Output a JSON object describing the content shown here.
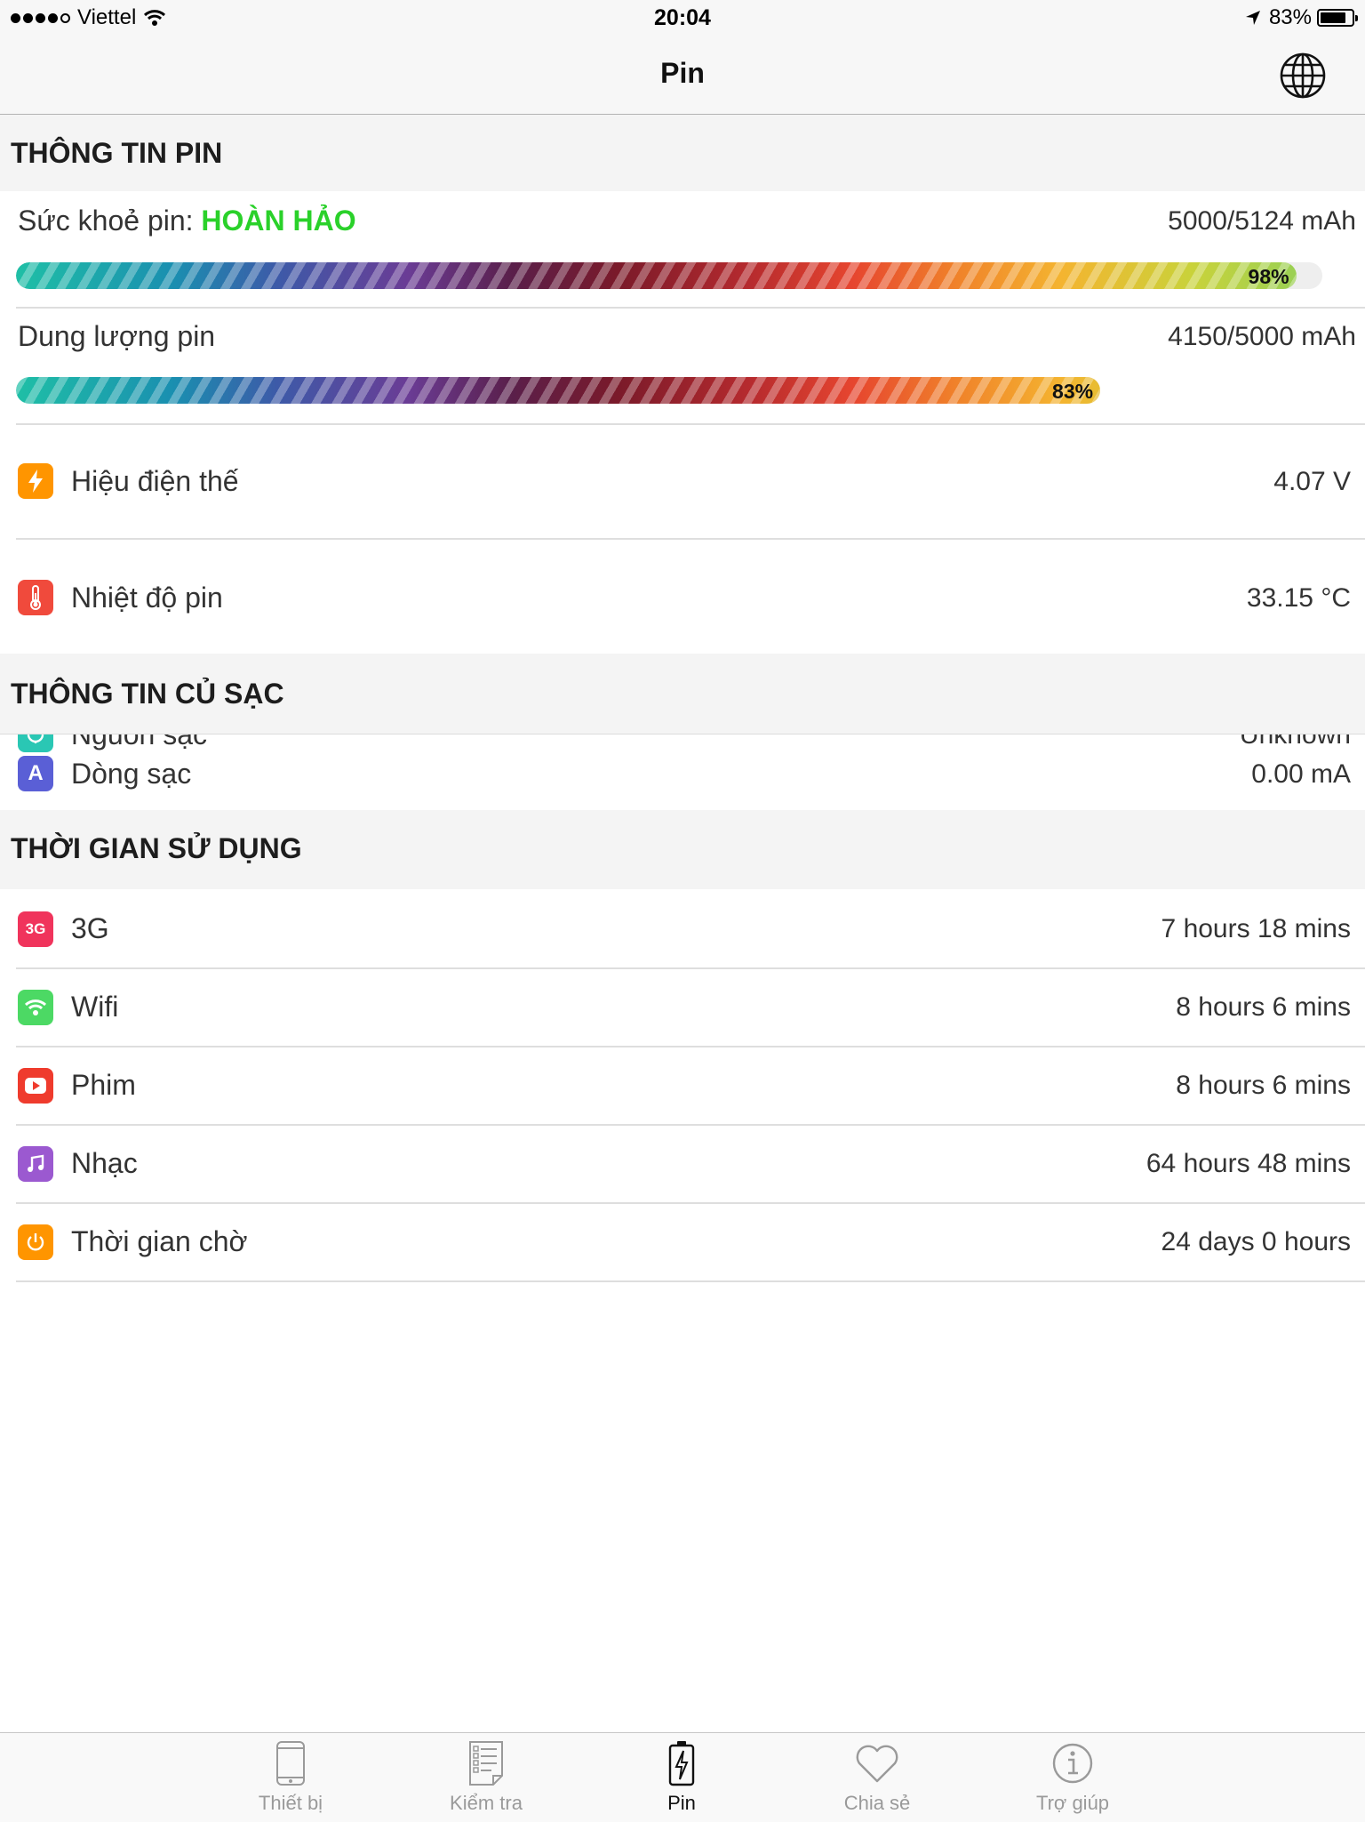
{
  "status_bar": {
    "carrier": "Viettel",
    "time": "20:04",
    "battery_text": "83%",
    "battery_level": 0.83
  },
  "nav": {
    "title": "Pin"
  },
  "battery_section": {
    "header": "THÔNG TIN PIN",
    "health": {
      "label": "Sức khoẻ pin: ",
      "status": "HOÀN HẢO",
      "value": "5000/5124 mAh",
      "percent_text": "98%",
      "percent": 98
    },
    "capacity": {
      "label": "Dung lượng pin",
      "value": "4150/5000 mAh",
      "percent_text": "83%",
      "percent": 83
    },
    "voltage": {
      "label": "Hiệu điện thế",
      "value": "4.07 V"
    },
    "temperature": {
      "label": "Nhiệt độ pin",
      "value": "33.15 °C"
    }
  },
  "charger_section": {
    "header": "THÔNG TIN CỦ SẠC",
    "source": {
      "label": "Nguồn sạc",
      "value": "Unknown"
    },
    "current": {
      "label": "Dòng sạc",
      "value": "0.00 mA",
      "icon_text": "A"
    }
  },
  "usage_section": {
    "header": "THỜI GIAN SỬ DỤNG",
    "items": [
      {
        "label": "3G",
        "value": "7 hours 18 mins",
        "icon_text": "3G"
      },
      {
        "label": "Wifi",
        "value": "8 hours 6 mins"
      },
      {
        "label": "Phim",
        "value": "8 hours 6 mins"
      },
      {
        "label": "Nhạc",
        "value": "64 hours 48 mins"
      },
      {
        "label": "Thời gian chờ",
        "value": "24 days 0 hours"
      }
    ]
  },
  "tabs": [
    {
      "label": "Thiết bị"
    },
    {
      "label": "Kiểm tra"
    },
    {
      "label": "Pin"
    },
    {
      "label": "Chia sẻ"
    },
    {
      "label": "Trợ giúp"
    }
  ],
  "colors": {
    "health_status": "#2ad12a",
    "voltage_icon": "#ff9500",
    "temperature_icon": "#f04a3c",
    "source_icon": "#2ac7b4",
    "current_icon": "#5a5fd6",
    "icon_3g": "#f0345c",
    "icon_wifi": "#4cd964",
    "icon_movie": "#ef3b2d",
    "icon_music": "#9b59d0",
    "icon_standby": "#ff9500"
  }
}
